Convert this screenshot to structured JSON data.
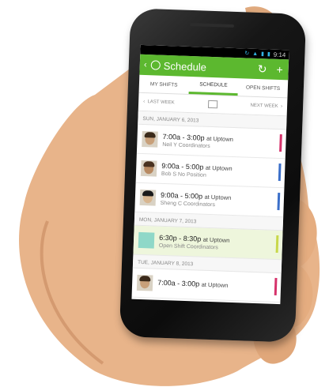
{
  "status": {
    "time": "9:14"
  },
  "header": {
    "title": "Schedule"
  },
  "tabs": [
    {
      "label": "MY SHIFTS"
    },
    {
      "label": "SCHEDULE"
    },
    {
      "label": "OPEN SHIFTS"
    }
  ],
  "weeknav": {
    "prev": "LAST WEEK",
    "next": "NEXT WEEK"
  },
  "days": [
    {
      "label": "SUN, JANUARY 6, 2013",
      "shifts": [
        {
          "time": "7:00a - 3:00p",
          "loc": "at Uptown",
          "name": "Neil  Y",
          "role": "Coordinators",
          "color": "#d6336c",
          "avatar": "#c8a07a",
          "hair": "#3b2a1a"
        },
        {
          "time": "9:00a - 5:00p",
          "loc": "at Uptown",
          "name": "Bob S",
          "role": "No Position",
          "color": "#3b6fc9",
          "avatar": "#b88a62",
          "hair": "#4a3220"
        },
        {
          "time": "9:00a - 5:00p",
          "loc": "at Uptown",
          "name": "Sheng C",
          "role": "Coordinators",
          "color": "#3b6fc9",
          "avatar": "#d8b690",
          "hair": "#1a1a1a"
        }
      ]
    },
    {
      "label": "MON, JANUARY 7, 2013",
      "shifts": [
        {
          "time": "6:30p - 8:30p",
          "loc": "at Uptown",
          "name": "Open Shift",
          "role": "Coordinators",
          "color": "#c8d84a",
          "open": true
        }
      ]
    },
    {
      "label": "TUE, JANUARY 8, 2013",
      "shifts": [
        {
          "time": "7:00a - 3:00p",
          "loc": "at Uptown",
          "name": "",
          "role": "",
          "color": "#d6336c",
          "avatar": "#c8a07a",
          "hair": "#3b2a1a"
        }
      ]
    }
  ]
}
